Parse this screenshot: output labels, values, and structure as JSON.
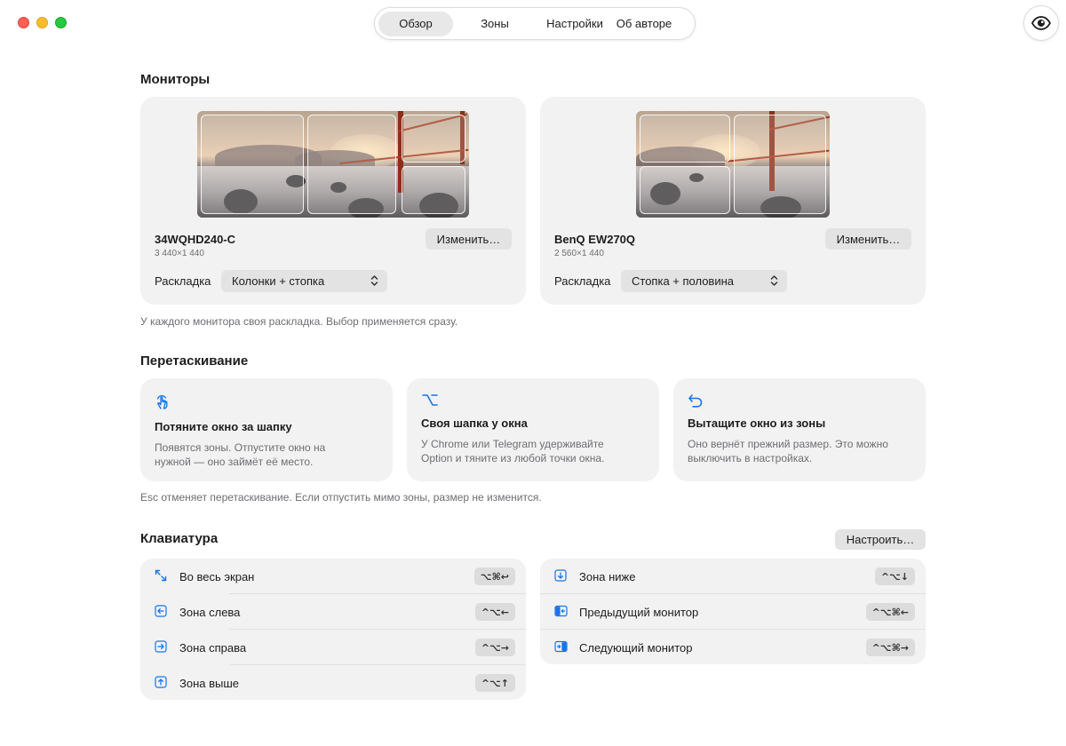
{
  "nav": {
    "tabs": [
      {
        "label": "Обзор",
        "active": true
      },
      {
        "label": "Зоны",
        "active": false
      },
      {
        "label": "Настройки",
        "active": false
      },
      {
        "label": "Об авторе",
        "active": false
      }
    ],
    "eye_icon": "eye-icon"
  },
  "monitors": {
    "title": "Мониторы",
    "items": [
      {
        "name": "34WQHD240-C",
        "resolution": "3 440×1 440",
        "change_label": "Изменить…",
        "layout_label": "Раскладка",
        "layout_value": "Колонки + стопка"
      },
      {
        "name": "BenQ EW270Q",
        "resolution": "2 560×1 440",
        "change_label": "Изменить…",
        "layout_label": "Раскладка",
        "layout_value": "Стопка + половина"
      }
    ],
    "caption": "У каждого монитора своя раскладка. Выбор применяется сразу."
  },
  "drag": {
    "title": "Перетаскивание",
    "cards": [
      {
        "icon": "hand-pointer-icon",
        "title": "Потяните окно за шапку",
        "desc1": "Появятся зоны. Отпустите окно на",
        "desc2": "нужной — оно займёт её место."
      },
      {
        "icon": "option-key-icon",
        "title": "Своя шапка у окна",
        "desc1": "У Chrome или Telegram удерживайте",
        "desc2": "Option и тяните из любой точки окна."
      },
      {
        "icon": "undo-arrow-icon",
        "title": "Вытащите окно из зоны",
        "desc1": "Оно вернёт прежний размер. Это можно",
        "desc2": "выключить в настройках."
      }
    ],
    "caption": "Esc отменяет перетаскивание. Если отпустить мимо зоны, размер не изменится."
  },
  "keyboard": {
    "title": "Клавиатура",
    "configure_label": "Настроить…",
    "left": [
      {
        "icon": "fullscreen-arrows-icon",
        "label": "Во весь экран",
        "keys": "⌥⌘↩"
      },
      {
        "icon": "arrow-left-square-icon",
        "label": "Зона слева",
        "keys": "^⌥←"
      },
      {
        "icon": "arrow-right-square-icon",
        "label": "Зона справа",
        "keys": "^⌥→"
      },
      {
        "icon": "arrow-up-square-icon",
        "label": "Зона выше",
        "keys": "^⌥↑"
      }
    ],
    "right": [
      {
        "icon": "arrow-down-square-icon",
        "label": "Зона ниже",
        "keys": "^⌥↓"
      },
      {
        "icon": "previous-monitor-icon",
        "label": "Предыдущий монитор",
        "keys": "^⌥⌘←"
      },
      {
        "icon": "next-monitor-icon",
        "label": "Следующий монитор",
        "keys": "^⌥⌘→"
      }
    ]
  },
  "colors": {
    "accent": "#1a73e8",
    "card_bg": "#f2f2f2",
    "secondary_text": "#6e6e73"
  }
}
